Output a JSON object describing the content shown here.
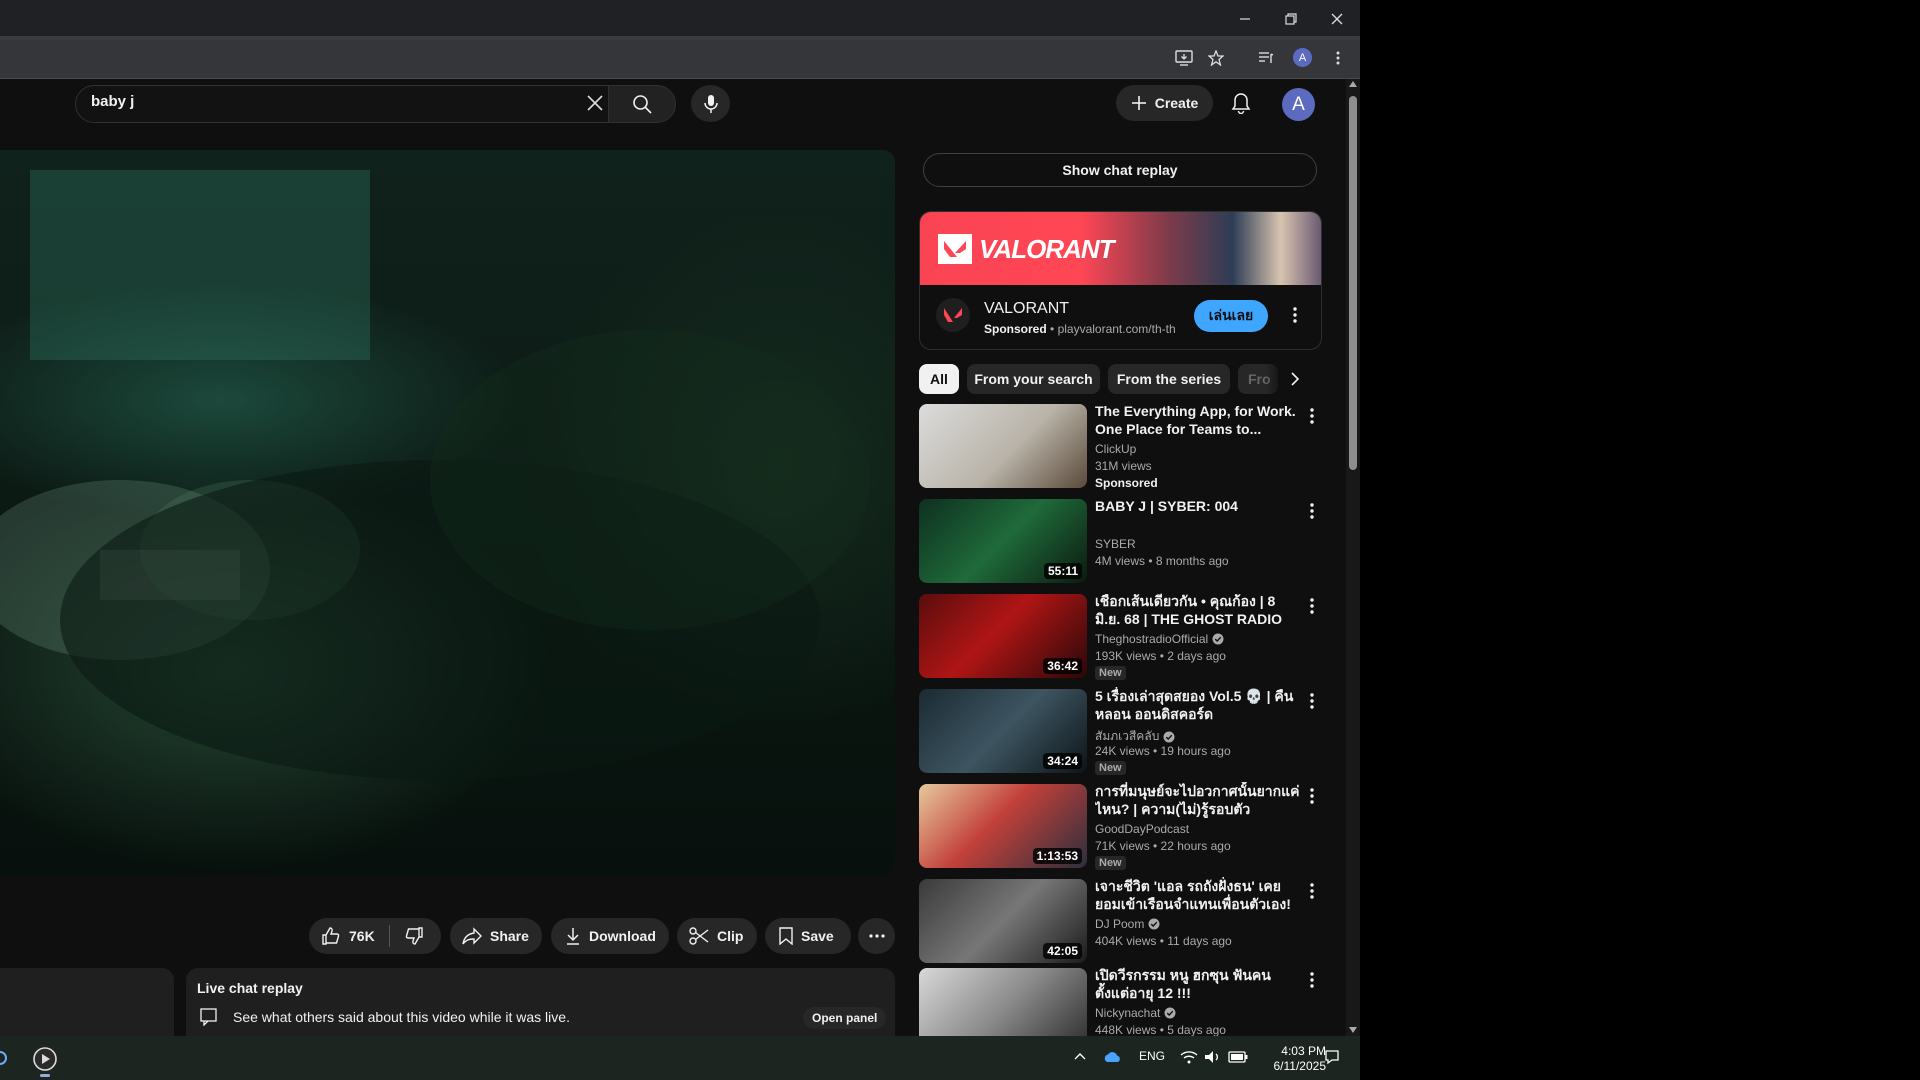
{
  "browser": {
    "window_controls": [
      "minimize",
      "restore",
      "close"
    ]
  },
  "masthead": {
    "search_value": "baby j",
    "create_label": "Create",
    "avatar_letter": "A"
  },
  "actions": {
    "likes": "76K",
    "share": "Share",
    "download": "Download",
    "clip": "Clip",
    "save": "Save"
  },
  "chat_panel": {
    "title": "Live chat replay",
    "description": "See what others said about this video while it was live.",
    "open_label": "Open panel"
  },
  "sidebar": {
    "show_chat_label": "Show chat replay",
    "ad": {
      "banner_text": "VALORANT",
      "name": "VALORANT",
      "sponsored": "Sponsored",
      "url": "playvalorant.com/th-th",
      "cta": "เล่นเลย"
    },
    "chips": [
      "All",
      "From your search",
      "From the series",
      "Fro"
    ],
    "recommendations": [
      {
        "title": "The Everything App, for Work. One Place for Teams to...",
        "channel": "ClickUp",
        "meta": "31M views",
        "badge": "Sponsored",
        "duration": "",
        "verified": false
      },
      {
        "title": "BABY J | SYBER: 004",
        "channel": "SYBER",
        "meta": "4M views • 8 months ago",
        "badge": "",
        "duration": "55:11",
        "verified": false
      },
      {
        "title": "เชือกเส้นเดียวกัน • คุณก้อง | 8 มิ.ย. 68 | THE GHOST RADIO",
        "channel": "TheghostradioOfficial",
        "meta": "193K views • 2 days ago",
        "badge": "New",
        "duration": "36:42",
        "verified": true
      },
      {
        "title": "5 เรื่องเล่าสุดสยอง Vol.5 💀 | คืนหลอน ออนดิสคอร์ด",
        "channel": "สัมภเวสีคลับ",
        "meta": "24K views • 19 hours ago",
        "badge": "New",
        "duration": "34:24",
        "verified": true
      },
      {
        "title": "การที่มนุษย์จะไปอวกาศนั้นยากแค่ไหน? | ความ(ไม่)รู้รอบตัว",
        "channel": "GoodDayPodcast",
        "meta": "71K views • 22 hours ago",
        "badge": "New",
        "duration": "1:13:53",
        "verified": false
      },
      {
        "title": "เจาะชีวิต 'แอล รถถังฝั่งธน' เคยยอมเข้าเรือนจำแทนเพื่อนตัวเอง!",
        "channel": "DJ Poom",
        "meta": "404K views • 11 days ago",
        "badge": "",
        "duration": "42:05",
        "verified": true
      },
      {
        "title": "เปิดวีรกรรม หนู ฮกซุน ฟันคนตั้งแต่อายุ 12 !!!",
        "channel": "Nickynachat",
        "meta": "448K views • 5 days ago",
        "badge": "",
        "duration": "",
        "verified": true
      }
    ]
  },
  "taskbar": {
    "lang": "ENG",
    "time": "4:03 PM",
    "date": "6/11/2025"
  },
  "colors": {
    "page_bg": "#0f0f0f",
    "cta_blue": "#3ea6ff",
    "valorant_red": "#ff4655"
  }
}
